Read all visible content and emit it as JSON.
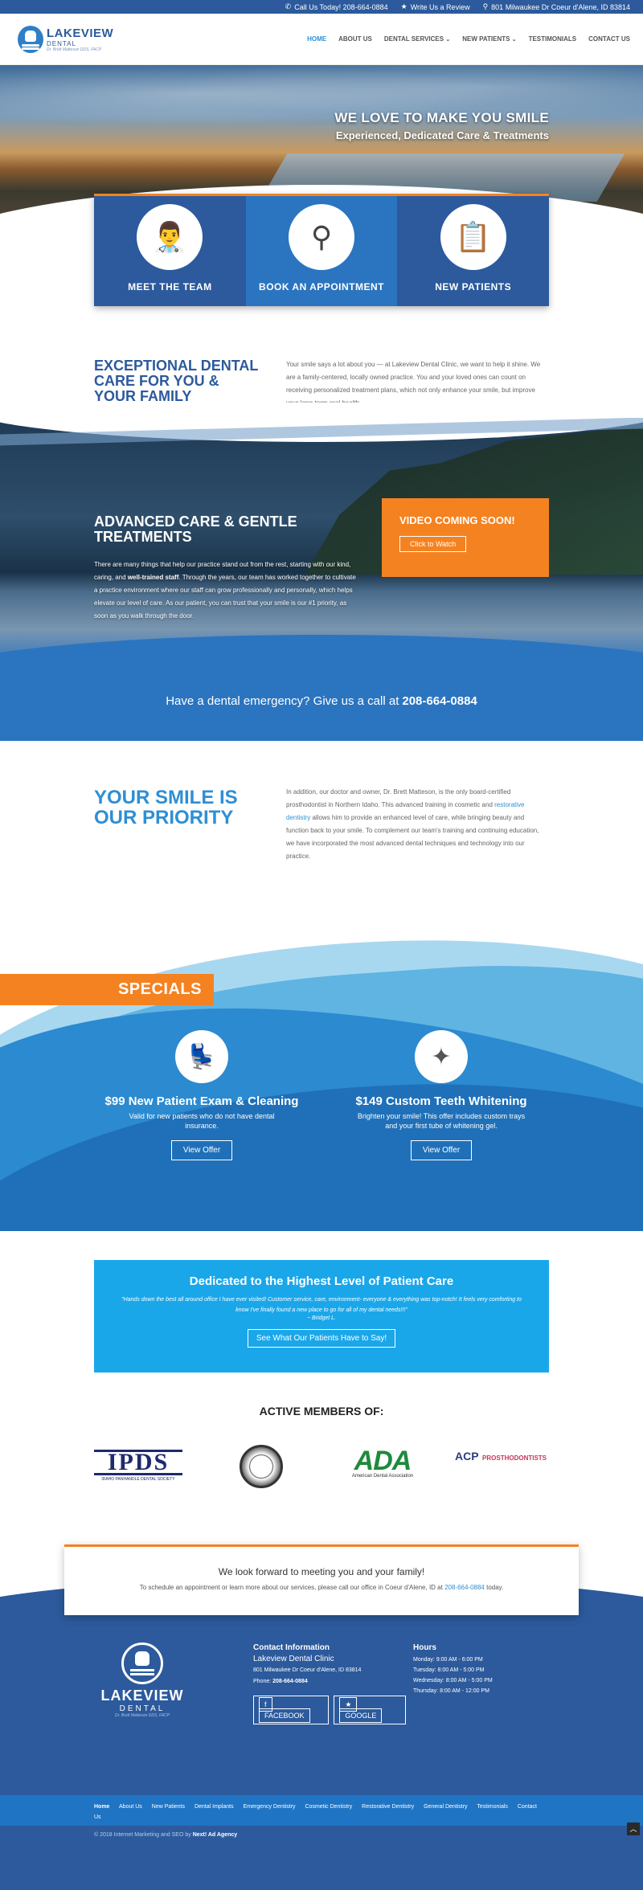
{
  "topbar": {
    "call": "Call Us Today! 208-664-0884",
    "review": "Write Us a Review",
    "address": "801 Milwaukee Dr Coeur d'Alene, ID 83814"
  },
  "brand": {
    "name": "LAKEVIEW",
    "sub": "DENTAL",
    "tagline": "Dr. Brett Matteson DDS, FACP"
  },
  "nav": [
    {
      "label": "HOME",
      "active": true
    },
    {
      "label": "ABOUT US"
    },
    {
      "label": "DENTAL SERVICES",
      "caret": true
    },
    {
      "label": "NEW PATIENTS",
      "caret": true
    },
    {
      "label": "TESTIMONIALS"
    },
    {
      "label": "CONTACT US"
    }
  ],
  "hero": {
    "title": "WE LOVE TO MAKE YOU SMILE",
    "subtitle": "Experienced, Dedicated Care & Treatments"
  },
  "cards": [
    {
      "label": "MEET THE TEAM",
      "icon": "doctor-icon"
    },
    {
      "label": "BOOK AN APPOINTMENT",
      "icon": "dental-tools-icon"
    },
    {
      "label": "NEW PATIENTS",
      "icon": "clipboard-icon"
    }
  ],
  "exceptional": {
    "title": "EXCEPTIONAL DENTAL CARE FOR YOU & YOUR FAMILY",
    "text": "Your smile says a lot about you — at Lakeview Dental Clinic, we want to help it shine. We are a family-centered, locally owned practice. You and your loved ones can count on receiving personalized treatment plans, which not only enhance your smile, but improve your long-term oral health."
  },
  "advanced": {
    "title": "ADVANCED CARE & GENTLE TREATMENTS",
    "text_a": "There are many things that help our practice stand out from the rest, starting with our kind, caring, and ",
    "text_bold": "well-trained staff",
    "text_b": ". Through the years, our team has worked together to cultivate a practice environment where our staff can grow professionally and personally, which helps elevate our level of care. As our patient, you can trust that your smile is our #1 priority, as soon as you walk through the door."
  },
  "video": {
    "title": "VIDEO COMING SOON!",
    "button": "Click to Watch"
  },
  "emergency": {
    "text": "Have a dental emergency? Give us a call at",
    "phone": "208-664-0884"
  },
  "priority": {
    "title": "YOUR SMILE IS OUR PRIORITY",
    "text_a": "In addition, our doctor and owner, Dr. Brett Matteson, is the only board-certified prosthodontist in Northern Idaho. This advanced training in cosmetic and ",
    "link": "restorative dentistry",
    "text_b": " allows him to provide an enhanced level of care, while bringing beauty and function back to your smile. To complement our team's training and continuing education, we have incorporated the most advanced dental techniques and technology into our practice."
  },
  "specials": {
    "title": "SPECIALS",
    "offers": [
      {
        "title": "$99 New Patient Exam & Cleaning",
        "desc": "Valid for new patients who do not have dental insurance.",
        "button": "View Offer",
        "icon": "dental-chair-icon"
      },
      {
        "title": "$149 Custom Teeth Whitening",
        "desc": "Brighten your smile! This offer includes custom trays and your first tube of whitening gel.",
        "button": "View Offer",
        "icon": "sparkling-tooth-icon"
      }
    ]
  },
  "testimonial": {
    "title": "Dedicated to the Highest Level of Patient Care",
    "quote": "\"Hands down the best all around office I have ever visited! Customer service, care, environment- everyone & everything was top-notch! It feels very comforting to know I've finally found a new place to go for all of my dental needs!!!\"",
    "author": "~ Bridget L.",
    "button": "See What Our Patients Have to Say!"
  },
  "members": {
    "title": "ACTIVE MEMBERS OF:",
    "ipds": "IPDS",
    "ipds_sub": "IDAHO PANHANDLE DENTAL SOCIETY",
    "ada": "ADA",
    "ada_sub": "American Dental Association",
    "acp": "ACP",
    "acp_sub": "PROSTHODONTISTS"
  },
  "cta": {
    "title": "We look forward to meeting you and your family!",
    "text_a": "To schedule an appointment or learn more about our services, please call our office in Coeur d'Alene, ID at ",
    "phone": "208-664-0884",
    "text_b": " today."
  },
  "footer": {
    "contact_title": "Contact Information",
    "clinic": "Lakeview Dental Clinic",
    "address": "801 Milwaukee Dr Coeur d'Alene, ID 83814",
    "phone_label": "Phone:",
    "phone": "208-664-0884",
    "facebook": "FACEBOOK",
    "google": "GOOGLE",
    "hours_title": "Hours",
    "hours": [
      "Monday: 9:00 AM - 6:00 PM",
      "Tuesday: 8:00 AM - 5:00 PM",
      "Wednesday: 8:00 AM - 5:00 PM",
      "Thursday: 8:00 AM - 12:00 PM"
    ],
    "links": [
      "Home",
      "About Us",
      "New Patients",
      "Dental Implants",
      "Emergency Dentistry",
      "Cosmetic Dentistry",
      "Restorative Dentistry",
      "General Dentistry",
      "Testimonials",
      "Contact Us"
    ],
    "copyright": "© 2018 Internet Marketing and SEO by",
    "agency": "Next! Ad Agency"
  },
  "colors": {
    "primary": "#2c5a9c",
    "accent": "#f58220",
    "light_blue": "#1aa7ea"
  }
}
